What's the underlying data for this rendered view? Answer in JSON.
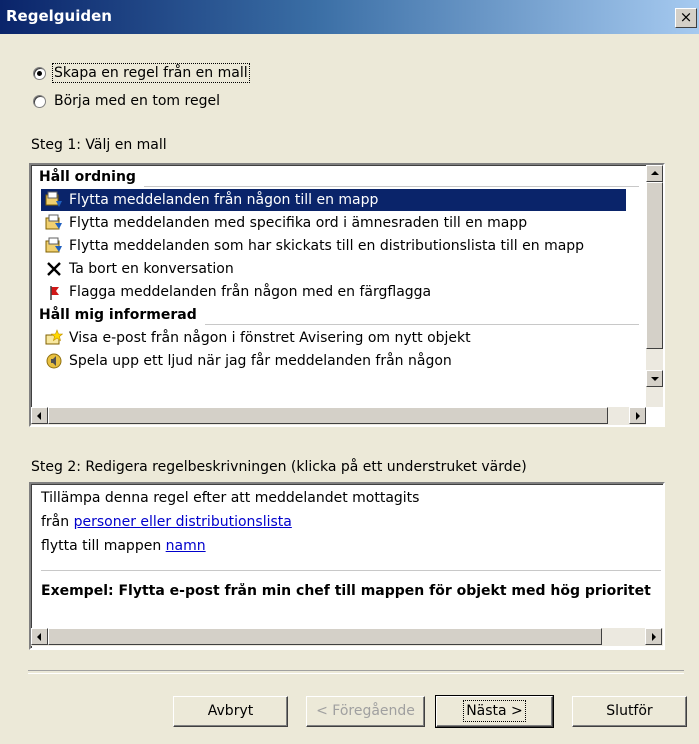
{
  "window": {
    "title": "Regelguiden",
    "close_label": "×"
  },
  "options": {
    "template": "Skapa en regel från en mall",
    "blank": "Börja med en tom regel"
  },
  "step1": {
    "label": "Steg 1: Välj en mall",
    "groups": [
      {
        "header": "Håll ordning"
      },
      {
        "header": "Håll mig informerad"
      }
    ],
    "items": [
      {
        "label": "Flytta meddelanden från någon till en mapp",
        "icon": "move-to-folder-icon"
      },
      {
        "label": "Flytta meddelanden med specifika ord i ämnesraden till en mapp",
        "icon": "move-to-folder-icon"
      },
      {
        "label": "Flytta meddelanden som har skickats till en distributionslista till en mapp",
        "icon": "move-to-folder-icon"
      },
      {
        "label": "Ta bort en konversation",
        "icon": "delete-x-icon"
      },
      {
        "label": "Flagga meddelanden från någon med en färgflagga",
        "icon": "red-flag-icon"
      },
      {
        "label": "Visa e-post från någon i fönstret Avisering om nytt objekt",
        "icon": "new-item-alert-icon"
      },
      {
        "label": "Spela upp ett ljud när jag får meddelanden från någon",
        "icon": "sound-icon"
      }
    ]
  },
  "step2": {
    "label": "Steg 2: Redigera regelbeskrivningen (klicka på ett understruket värde)",
    "line1": "Tillämpa denna regel efter att meddelandet mottagits",
    "line2_prefix": "från ",
    "line2_link": "personer eller distributionslista",
    "line3_prefix": "flytta till mappen ",
    "line3_link": "namn",
    "example": "Exempel: Flytta e-post från min chef till mappen för objekt med hög prioritet"
  },
  "buttons": {
    "cancel": "Avbryt",
    "back": "< Föregående",
    "next": "Nästa >",
    "finish": "Slutför"
  },
  "colors": {
    "selection": "#0a246a",
    "link": "#0000cc",
    "titlebar_start": "#0a246a",
    "titlebar_end": "#a6caf0"
  }
}
